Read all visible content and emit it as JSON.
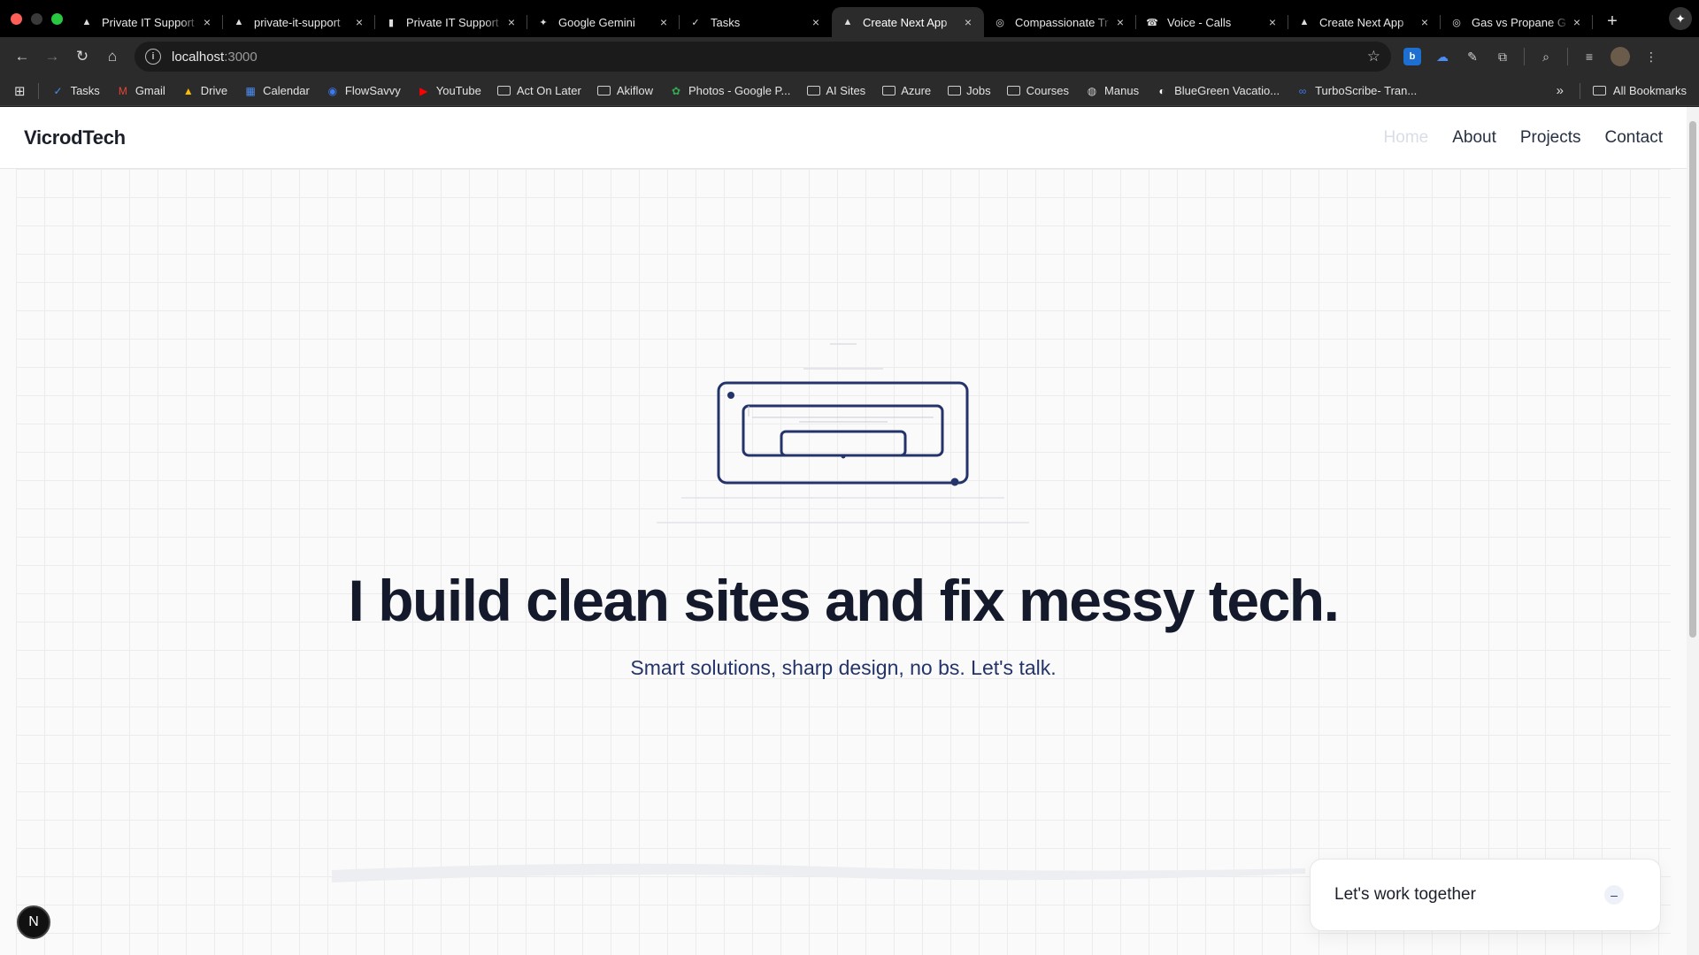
{
  "browser": {
    "tabs": [
      {
        "title": "Private IT Support",
        "fav": "▲"
      },
      {
        "title": "private-it-support",
        "fav": "▲"
      },
      {
        "title": "Private IT Support",
        "fav": "▮"
      },
      {
        "title": "Google Gemini",
        "fav": "✦"
      },
      {
        "title": "Tasks",
        "fav": "✓"
      },
      {
        "title": "Create Next App",
        "fav": "▲"
      },
      {
        "title": "Compassionate Tr",
        "fav": "◎"
      },
      {
        "title": "Voice - Calls",
        "fav": "☎"
      },
      {
        "title": "Create Next App",
        "fav": "▲"
      },
      {
        "title": "Gas vs Propane G",
        "fav": "◎"
      }
    ],
    "active_tab_index": 5,
    "close_glyph": "×",
    "new_tab_glyph": "+",
    "address": {
      "host": "localhost",
      "port": ":3000"
    },
    "bookmarks": [
      {
        "label": "Tasks",
        "icon": "tasks-icon",
        "glyph": "✓",
        "color": "#4b8df5"
      },
      {
        "label": "Gmail",
        "icon": "gmail-icon",
        "glyph": "M",
        "color": "#ea4335"
      },
      {
        "label": "Drive",
        "icon": "drive-icon",
        "glyph": "▲",
        "color": "#fbbc04"
      },
      {
        "label": "Calendar",
        "icon": "calendar-icon",
        "glyph": "▦",
        "color": "#4b8df5"
      },
      {
        "label": "FlowSavvy",
        "icon": "flowsavvy-icon",
        "glyph": "◉",
        "color": "#3b7bf0"
      },
      {
        "label": "YouTube",
        "icon": "youtube-icon",
        "glyph": "▶",
        "color": "#ff0000"
      },
      {
        "label": "Act On Later",
        "icon": "folder-icon",
        "glyph": "",
        "color": ""
      },
      {
        "label": "Akiflow",
        "icon": "folder-icon",
        "glyph": "",
        "color": ""
      },
      {
        "label": "Photos - Google P...",
        "icon": "photos-icon",
        "glyph": "✿",
        "color": "#34a853"
      },
      {
        "label": "AI Sites",
        "icon": "folder-icon",
        "glyph": "",
        "color": ""
      },
      {
        "label": "Azure",
        "icon": "folder-icon",
        "glyph": "",
        "color": ""
      },
      {
        "label": "Jobs",
        "icon": "folder-icon",
        "glyph": "",
        "color": ""
      },
      {
        "label": "Courses",
        "icon": "folder-icon",
        "glyph": "",
        "color": ""
      },
      {
        "label": "Manus",
        "icon": "manus-icon",
        "glyph": "◍",
        "color": "#cccccc"
      },
      {
        "label": "BlueGreen Vacatio...",
        "icon": "bluegreen-icon",
        "glyph": "◐",
        "color": "#ffffff"
      },
      {
        "label": "TurboScribe- Tran...",
        "icon": "turboscribe-icon",
        "glyph": "∞",
        "color": "#3b7bf0"
      }
    ],
    "all_bookmarks_label": "All Bookmarks",
    "more_glyph": "»"
  },
  "site": {
    "brand": "VicrodTech",
    "nav": [
      {
        "label": "Home",
        "active": true
      },
      {
        "label": "About",
        "active": false
      },
      {
        "label": "Projects",
        "active": false
      },
      {
        "label": "Contact",
        "active": false
      }
    ],
    "headline": "I build clean sites and fix messy tech.",
    "subline": "Smart solutions, sharp design, no bs. Let's talk.",
    "cta": {
      "label": "Let's work together",
      "toggle": "–"
    },
    "next_badge": "N"
  },
  "colors": {
    "accent": "#24346b",
    "ink": "#141a2b",
    "nav_active": "#d9dde6"
  }
}
